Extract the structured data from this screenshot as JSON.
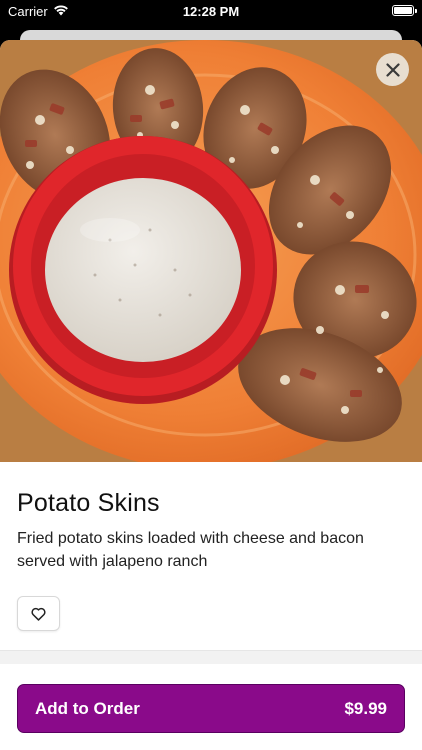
{
  "status_bar": {
    "carrier": "Carrier",
    "time": "12:28 PM",
    "wifi_icon": "wifi-icon",
    "battery_icon": "battery-icon"
  },
  "item": {
    "name": "Potato Skins",
    "description": "Fried potato skins loaded with cheese and bacon served with jalapeno ranch",
    "image_alt": "Potato skins with a bowl of jalapeno ranch on an orange plate"
  },
  "actions": {
    "close_icon": "close-icon",
    "favorite_icon": "heart-icon",
    "add_to_order_label": "Add to Order",
    "price": "$9.99"
  },
  "colors": {
    "primary": "#8a0a8a",
    "plate": "#f0873a",
    "bowl": "#e0262b",
    "ranch": "#ece8e2"
  }
}
